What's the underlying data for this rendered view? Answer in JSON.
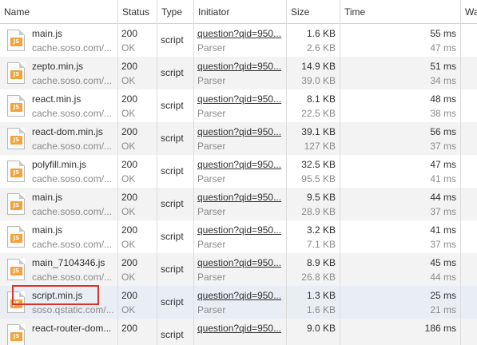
{
  "columns": {
    "name": "Name",
    "status": "Status",
    "type": "Type",
    "initiator": "Initiator",
    "size": "Size",
    "time": "Time",
    "waterfall": "Wa"
  },
  "icon": {
    "name": "js-file-icon",
    "badge_text": "JS",
    "badge_color": "#f4a23a"
  },
  "highlight_color": "#d9342b",
  "rows": [
    {
      "name": "main.js",
      "domain": "cache.soso.com/...",
      "status": "200",
      "status_text": "OK",
      "type": "script",
      "initiator": "question?qid=950...",
      "initiator_type": "Parser",
      "size": "1.6 KB",
      "content": "2.6 KB",
      "time": "55 ms",
      "latency": "47 ms"
    },
    {
      "name": "zepto.min.js",
      "domain": "cache.soso.com/...",
      "status": "200",
      "status_text": "OK",
      "type": "script",
      "initiator": "question?qid=950...",
      "initiator_type": "Parser",
      "size": "14.9 KB",
      "content": "39.0 KB",
      "time": "51 ms",
      "latency": "34 ms"
    },
    {
      "name": "react.min.js",
      "domain": "cache.soso.com/...",
      "status": "200",
      "status_text": "OK",
      "type": "script",
      "initiator": "question?qid=950...",
      "initiator_type": "Parser",
      "size": "8.1 KB",
      "content": "22.5 KB",
      "time": "48 ms",
      "latency": "38 ms"
    },
    {
      "name": "react-dom.min.js",
      "domain": "cache.soso.com/...",
      "status": "200",
      "status_text": "OK",
      "type": "script",
      "initiator": "question?qid=950...",
      "initiator_type": "Parser",
      "size": "39.1 KB",
      "content": "127 KB",
      "time": "56 ms",
      "latency": "37 ms"
    },
    {
      "name": "polyfill.min.js",
      "domain": "cache.soso.com/...",
      "status": "200",
      "status_text": "OK",
      "type": "script",
      "initiator": "question?qid=950...",
      "initiator_type": "Parser",
      "size": "32.5 KB",
      "content": "95.5 KB",
      "time": "47 ms",
      "latency": "41 ms"
    },
    {
      "name": "main.js",
      "domain": "cache.soso.com/...",
      "status": "200",
      "status_text": "OK",
      "type": "script",
      "initiator": "question?qid=950...",
      "initiator_type": "Parser",
      "size": "9.5 KB",
      "content": "28.9 KB",
      "time": "44 ms",
      "latency": "37 ms"
    },
    {
      "name": "main.js",
      "domain": "cache.soso.com/...",
      "status": "200",
      "status_text": "OK",
      "type": "script",
      "initiator": "question?qid=950...",
      "initiator_type": "Parser",
      "size": "3.2 KB",
      "content": "7.1 KB",
      "time": "41 ms",
      "latency": "37 ms"
    },
    {
      "name": "main_7104346.js",
      "domain": "cache.soso.com/...",
      "status": "200",
      "status_text": "OK",
      "type": "script",
      "initiator": "question?qid=950...",
      "initiator_type": "Parser",
      "size": "8.9 KB",
      "content": "26.8 KB",
      "time": "45 ms",
      "latency": "44 ms"
    },
    {
      "name": "script.min.js",
      "domain": "soso.qstatic.com/...",
      "status": "200",
      "status_text": "OK",
      "type": "script",
      "initiator": "question?qid=950...",
      "initiator_type": "Parser",
      "size": "1.3 KB",
      "content": "1.6 KB",
      "time": "25 ms",
      "latency": "21 ms"
    },
    {
      "name": "react-router-dom...",
      "domain": "",
      "status": "200",
      "status_text": "",
      "type": "script",
      "initiator": "question?qid=950...",
      "initiator_type": "",
      "size": "9.0 KB",
      "content": "",
      "time": "186 ms",
      "latency": ""
    }
  ]
}
